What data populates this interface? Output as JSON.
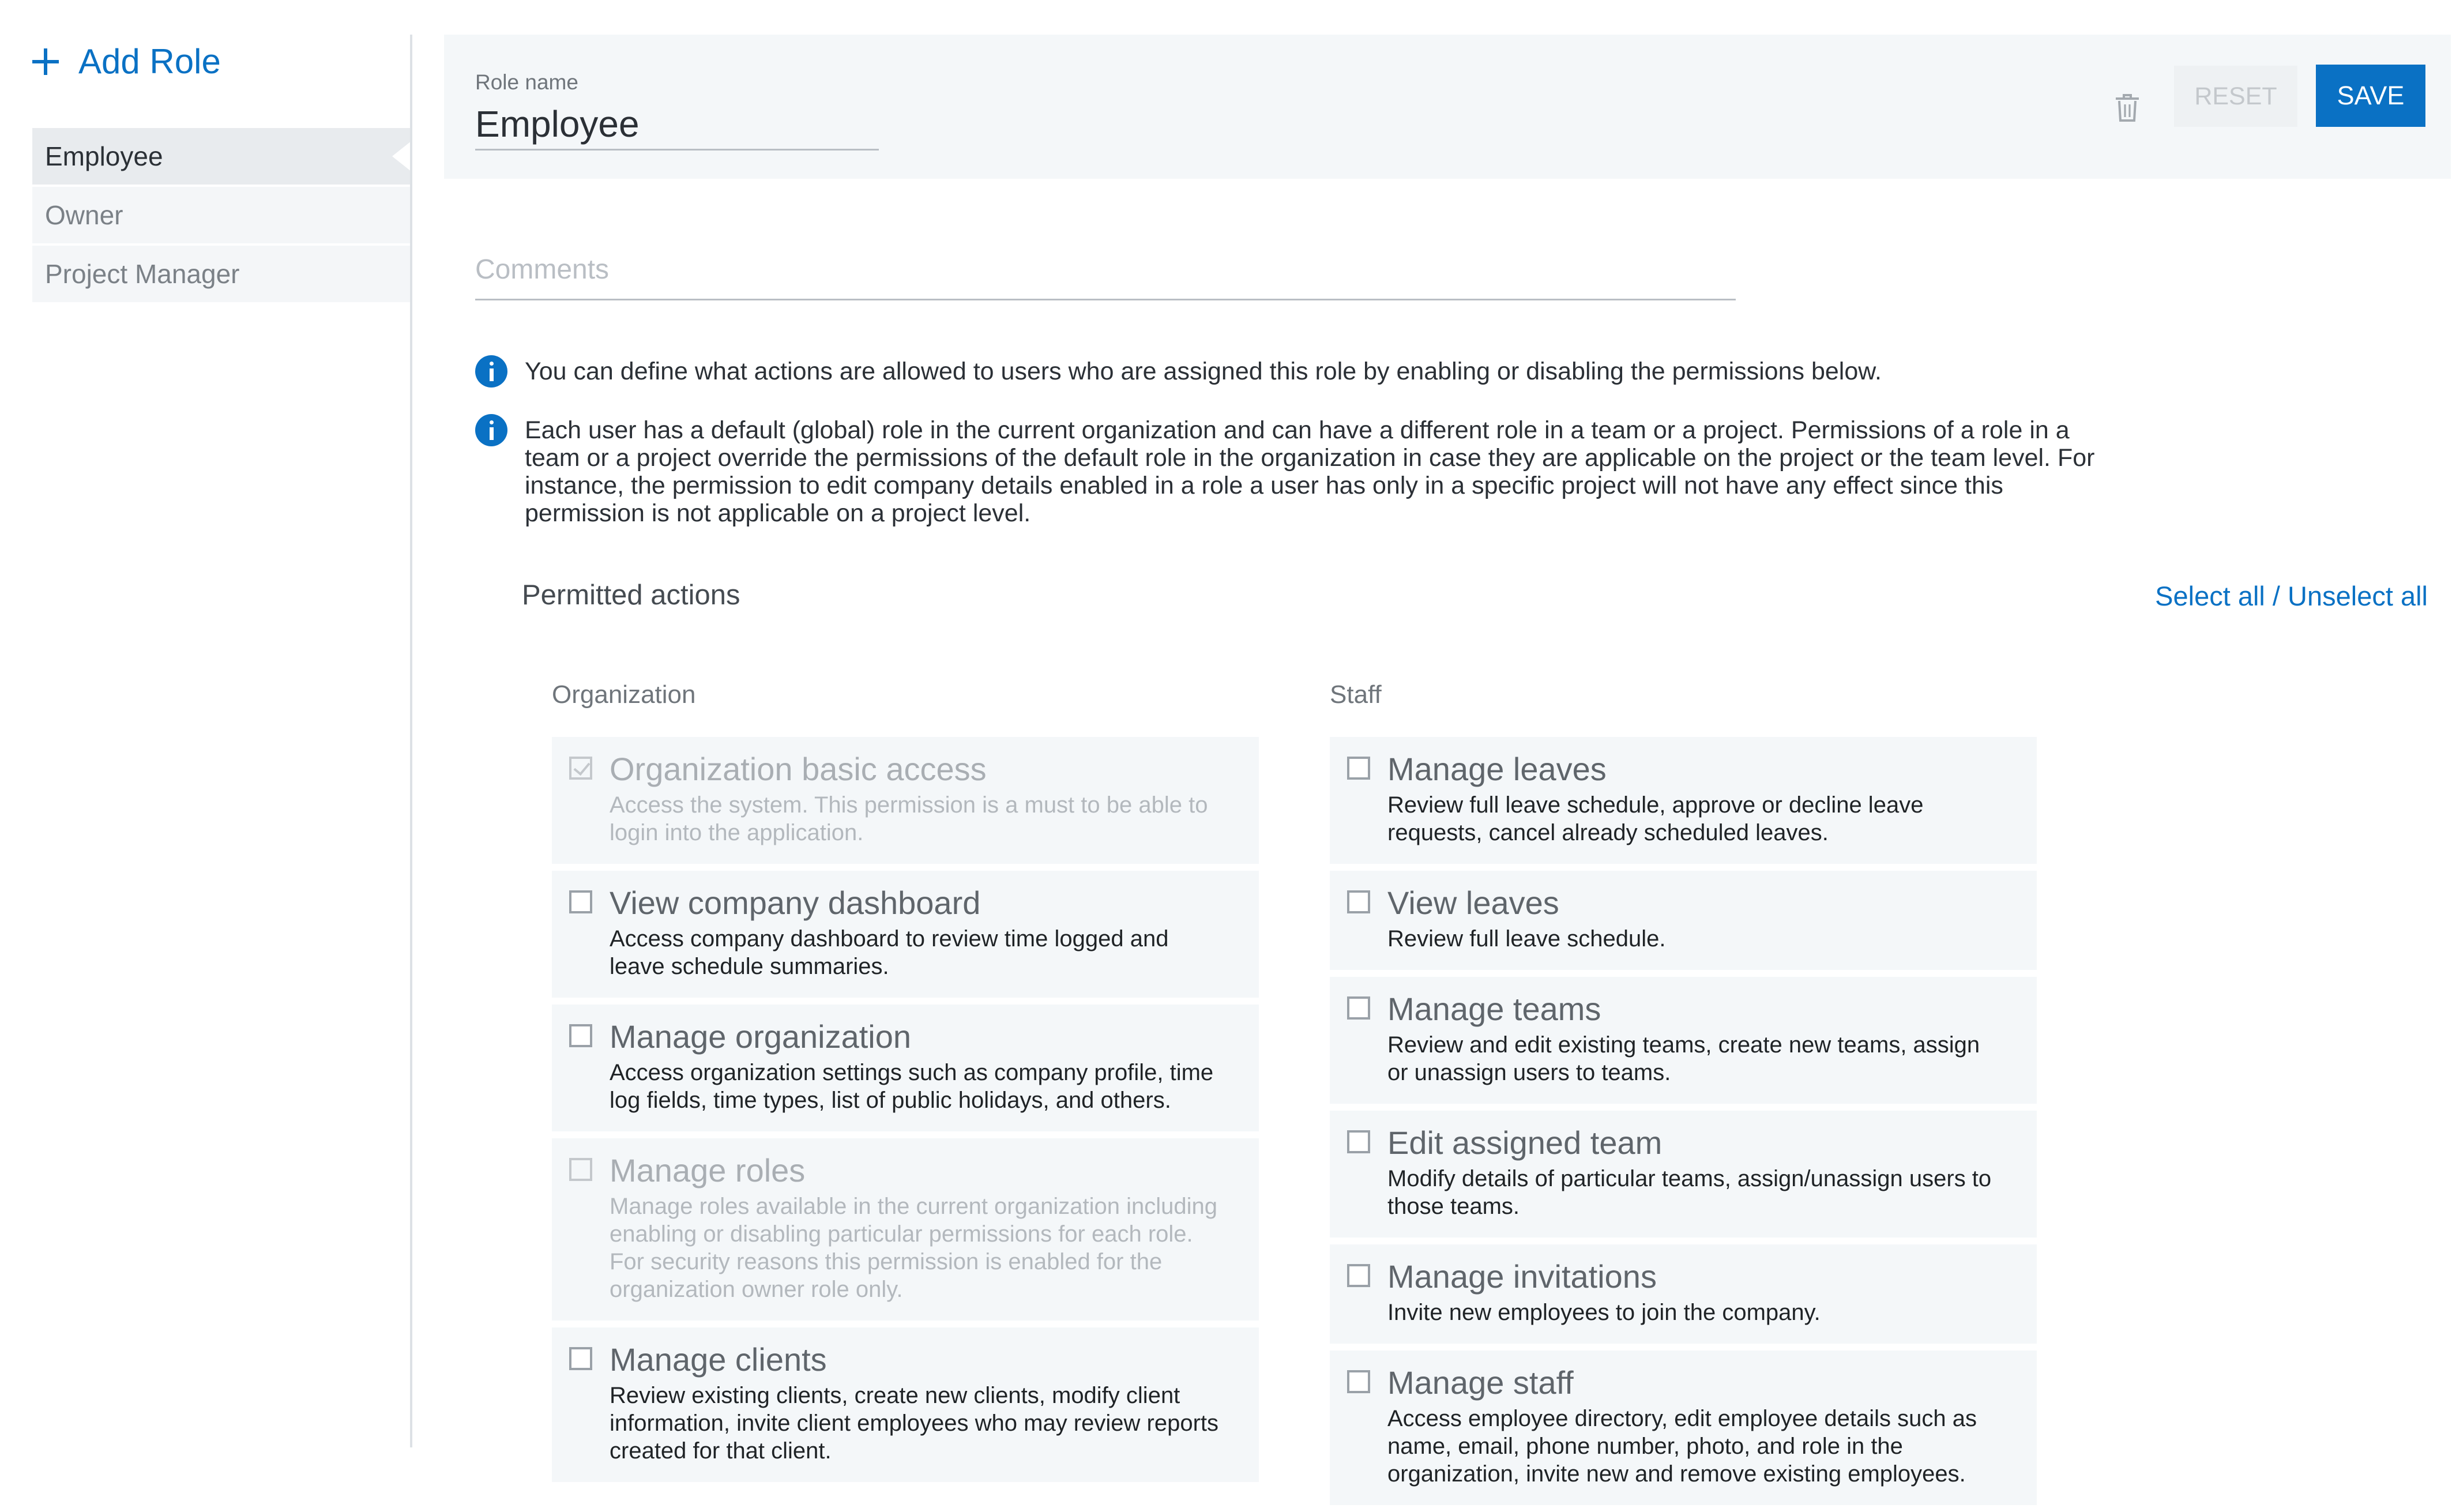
{
  "sidebar": {
    "add_role_label": "Add Role",
    "roles": [
      "Employee",
      "Owner",
      "Project Manager"
    ],
    "active_role": "Employee"
  },
  "header": {
    "role_name_label": "Role name",
    "role_name_value": "Employee",
    "reset_label": "RESET",
    "save_label": "SAVE"
  },
  "comments": {
    "placeholder": "Comments"
  },
  "info": [
    "You can define what actions are allowed to users who are assigned this role by enabling or disabling the permissions below.",
    "Each user has a default (global) role in the current organization and can have a different role in a team or a project. Permissions of a role in a team or a project override the permissions of the default role in the organization in case they are applicable on the project or the team level. For instance, the permission to edit company details enabled in a role a user has only in a specific project will not have any effect since this permission is not applicable on a project level."
  ],
  "permissions": {
    "title": "Permitted actions",
    "select_all": "Select all",
    "separator": "/",
    "unselect_all": "Unselect all",
    "organization": {
      "title": "Organization",
      "items": [
        {
          "title": "Organization basic access",
          "desc": "Access the system. This permission is a must to be able to login into the application.",
          "checked": true,
          "disabled": true
        },
        {
          "title": "View company dashboard",
          "desc": "Access company dashboard to review time logged and leave schedule summaries.",
          "checked": false,
          "disabled": false
        },
        {
          "title": "Manage organization",
          "desc": "Access organization settings such as company profile, time log fields, time types, list of public holidays, and others.",
          "checked": false,
          "disabled": false
        },
        {
          "title": "Manage roles",
          "desc": "Manage roles available in the current organization including enabling or disabling particular permissions for each role. For security reasons this permission is enabled for the organization owner role only.",
          "checked": false,
          "disabled": true
        },
        {
          "title": "Manage clients",
          "desc": "Review existing clients, create new clients, modify client information, invite client employees who may review reports created for that client.",
          "checked": false,
          "disabled": false
        }
      ]
    },
    "staff": {
      "title": "Staff",
      "items": [
        {
          "title": "Manage leaves",
          "desc": "Review full leave schedule, approve or decline leave requests, cancel already scheduled leaves.",
          "checked": false,
          "disabled": false
        },
        {
          "title": "View leaves",
          "desc": "Review full leave schedule.",
          "checked": false,
          "disabled": false
        },
        {
          "title": "Manage teams",
          "desc": "Review and edit existing teams, create new teams, assign or unassign users to teams.",
          "checked": false,
          "disabled": false
        },
        {
          "title": "Edit assigned team",
          "desc": "Modify details of particular teams, assign/unassign users to those teams.",
          "checked": false,
          "disabled": false
        },
        {
          "title": "Manage invitations",
          "desc": "Invite new employees to join the company.",
          "checked": false,
          "disabled": false
        },
        {
          "title": "Manage staff",
          "desc": "Access employee directory, edit employee details such as name, email, phone number, photo, and role in the organization, invite new and remove existing employees.",
          "checked": false,
          "disabled": false
        }
      ]
    }
  },
  "colors": {
    "accent": "#0a71c4",
    "card_bg": "#f4f7f9",
    "muted_text": "#6f757b"
  },
  "icons": {
    "add": "plus-icon",
    "delete": "trash-icon",
    "info": "info-icon",
    "checkbox": "checkbox-icon"
  }
}
